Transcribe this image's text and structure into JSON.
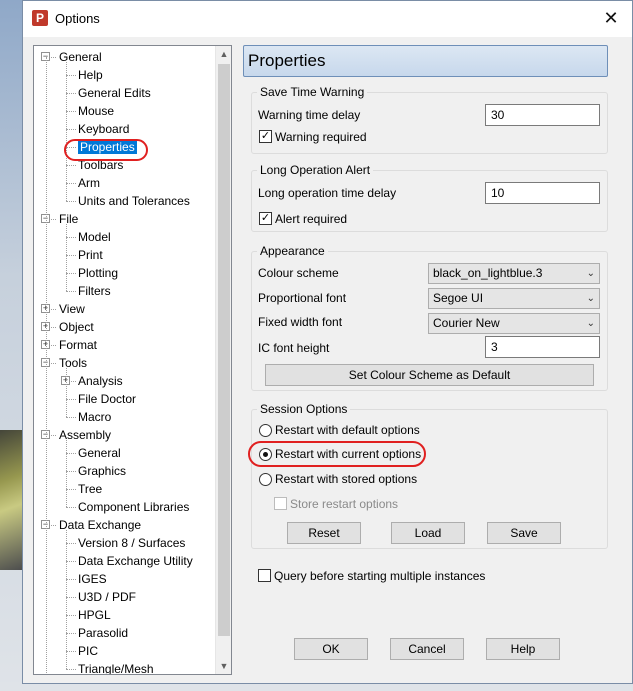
{
  "window": {
    "title": "Options"
  },
  "tree": [
    {
      "label": "General",
      "level": 0,
      "expander": "−"
    },
    {
      "label": "Help",
      "level": 1
    },
    {
      "label": "General Edits",
      "level": 1
    },
    {
      "label": "Mouse",
      "level": 1
    },
    {
      "label": "Keyboard",
      "level": 1
    },
    {
      "label": "Properties",
      "level": 1,
      "selected": true
    },
    {
      "label": "Toolbars",
      "level": 1
    },
    {
      "label": "Arm",
      "level": 1
    },
    {
      "label": "Units and Tolerances",
      "level": 1
    },
    {
      "label": "File",
      "level": 0,
      "expander": "−"
    },
    {
      "label": "Model",
      "level": 1
    },
    {
      "label": "Print",
      "level": 1
    },
    {
      "label": "Plotting",
      "level": 1
    },
    {
      "label": "Filters",
      "level": 1
    },
    {
      "label": "View",
      "level": 0,
      "expander": "+"
    },
    {
      "label": "Object",
      "level": 0,
      "expander": "+"
    },
    {
      "label": "Format",
      "level": 0,
      "expander": "+"
    },
    {
      "label": "Tools",
      "level": 0,
      "expander": "−"
    },
    {
      "label": "Analysis",
      "level": 1,
      "expander": "+"
    },
    {
      "label": "File Doctor",
      "level": 1
    },
    {
      "label": "Macro",
      "level": 1
    },
    {
      "label": "Assembly",
      "level": 0,
      "expander": "−"
    },
    {
      "label": "General",
      "level": 1
    },
    {
      "label": "Graphics",
      "level": 1
    },
    {
      "label": "Tree",
      "level": 1
    },
    {
      "label": "Component Libraries",
      "level": 1
    },
    {
      "label": "Data Exchange",
      "level": 0,
      "expander": "−"
    },
    {
      "label": "Version 8 / Surfaces",
      "level": 1
    },
    {
      "label": "Data Exchange Utility",
      "level": 1
    },
    {
      "label": "IGES",
      "level": 1
    },
    {
      "label": "U3D / PDF",
      "level": 1
    },
    {
      "label": "HPGL",
      "level": 1
    },
    {
      "label": "Parasolid",
      "level": 1
    },
    {
      "label": "PIC",
      "level": 1
    },
    {
      "label": "Triangle/Mesh",
      "level": 1
    }
  ],
  "panel": {
    "header": "Properties",
    "save_time": {
      "title": "Save Time Warning",
      "delay_label": "Warning time delay",
      "delay_value": "30",
      "required_label": "Warning required",
      "required_checked": true
    },
    "long_op": {
      "title": "Long Operation Alert",
      "delay_label": "Long operation time delay",
      "delay_value": "10",
      "required_label": "Alert required",
      "required_checked": true
    },
    "appearance": {
      "title": "Appearance",
      "colour_label": "Colour scheme",
      "colour_value": "black_on_lightblue.3",
      "prop_font_label": "Proportional font",
      "prop_font_value": "Segoe UI",
      "fixed_font_label": "Fixed width font",
      "fixed_font_value": "Courier New",
      "ic_height_label": "IC font height",
      "ic_height_value": "3",
      "set_default_btn": "Set Colour Scheme as Default"
    },
    "session": {
      "title": "Session Options",
      "opt_default": "Restart with default options",
      "opt_current": "Restart with current options",
      "opt_stored": "Restart with stored options",
      "selected": "current",
      "store_label": "Store restart options",
      "reset_btn": "Reset",
      "load_btn": "Load",
      "save_btn": "Save"
    },
    "query_label": "Query before starting multiple instances"
  },
  "footer": {
    "ok": "OK",
    "cancel": "Cancel",
    "help": "Help"
  },
  "colors": {
    "selection": "#0078d7",
    "annotation": "#e02020",
    "header_bg": "#c7d8ec"
  }
}
